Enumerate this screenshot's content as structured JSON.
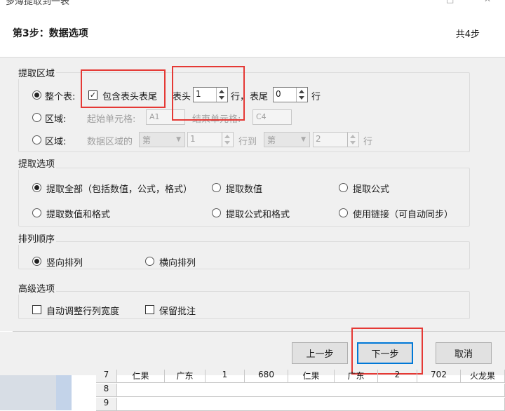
{
  "window": {
    "title": "多薄提取到一表"
  },
  "header": {
    "step": "第3步：数据选项",
    "total": "共4步"
  },
  "extract_area": {
    "title": "提取区域",
    "whole_table": {
      "label": "整个表:",
      "include_header_footer": "包含表头表尾",
      "header_label": "表头",
      "header_value": "1",
      "row_label": "行，",
      "footer_label": "表尾",
      "footer_value": "0",
      "row_label2": "行"
    },
    "region_cells": {
      "label": "区域:",
      "start_label": "起始单元格:",
      "start_value": "A1",
      "end_label": "结束单元格:",
      "end_value": "C4"
    },
    "region_rows": {
      "label": "区域:",
      "prefix": "数据区域的",
      "select1": "第",
      "value1": "1",
      "to": "行到",
      "select2": "第",
      "value2": "2",
      "suffix": "行"
    }
  },
  "extract_options": {
    "title": "提取选项",
    "items": [
      "提取全部（包括数值，公式，格式）",
      "提取数值",
      "提取公式",
      "提取数值和格式",
      "提取公式和格式",
      "使用链接（可自动同步）"
    ]
  },
  "sort_order": {
    "title": "排列顺序",
    "vertical": "竖向排列",
    "horizontal": "横向排列"
  },
  "advanced": {
    "title": "高级选项",
    "autofit": "自动调整行列宽度",
    "keep_comments": "保留批注"
  },
  "buttons": {
    "prev": "上一步",
    "next": "下一步",
    "cancel": "取消"
  },
  "sheet": {
    "row7": {
      "num": "7",
      "cells": [
        "仁果",
        "广东",
        "1",
        "680",
        "仁果",
        "广东",
        "2",
        "702",
        "火龙果"
      ]
    },
    "row8": {
      "num": "8"
    },
    "row9": {
      "num": "9"
    }
  },
  "colors": {
    "accent": "#0078d7",
    "highlight": "#e53935",
    "panel": "#f0f0f0"
  }
}
